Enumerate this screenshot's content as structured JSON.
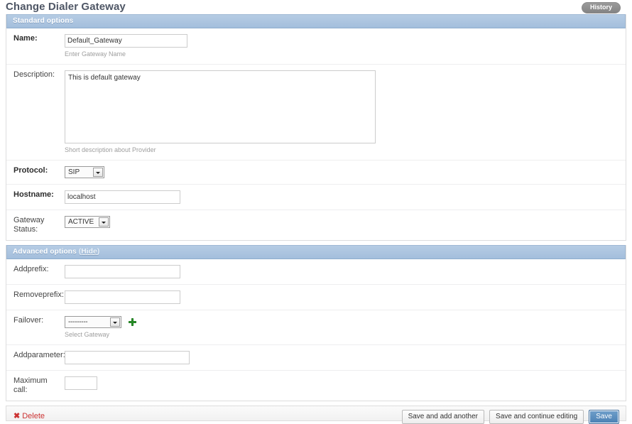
{
  "header": {
    "title": "Change Dialer Gateway",
    "history_label": "History"
  },
  "standard_section": {
    "title": "Standard options",
    "fields": {
      "name": {
        "label": "Name:",
        "value": "Default_Gateway",
        "help": "Enter Gateway Name"
      },
      "description": {
        "label": "Description:",
        "value": "This is default gateway",
        "help": "Short description about Provider"
      },
      "protocol": {
        "label": "Protocol:",
        "value": "SIP"
      },
      "hostname": {
        "label": "Hostname:",
        "value": "localhost"
      },
      "gateway_status": {
        "label": "Gateway Status:",
        "value": "ACTIVE"
      }
    }
  },
  "advanced_section": {
    "title": "Advanced options",
    "paren_open": "(",
    "toggle_label": "Hide",
    "paren_close": ")",
    "fields": {
      "addprefix": {
        "label": "Addprefix:",
        "value": ""
      },
      "removeprefix": {
        "label": "Removeprefix:",
        "value": ""
      },
      "failover": {
        "label": "Failover:",
        "value": "---------",
        "help": "Select Gateway",
        "add_icon": "plus-icon"
      },
      "addparameter": {
        "label": "Addparameter:",
        "value": ""
      },
      "maximum_call": {
        "label": "Maximum call:",
        "value": ""
      }
    }
  },
  "submit_row": {
    "delete_icon": "✖",
    "delete_label": "Delete",
    "save_add_another_label": "Save and add another",
    "save_continue_label": "Save and continue editing",
    "save_label": "Save"
  },
  "colors": {
    "section_header_bg": "#a3bedc",
    "primary_button": "#4b80b4",
    "delete_link": "#cc3333",
    "help_text": "#9e9e9e",
    "title_text": "#4e5665",
    "add_icon_green": "#2e9b2e"
  }
}
